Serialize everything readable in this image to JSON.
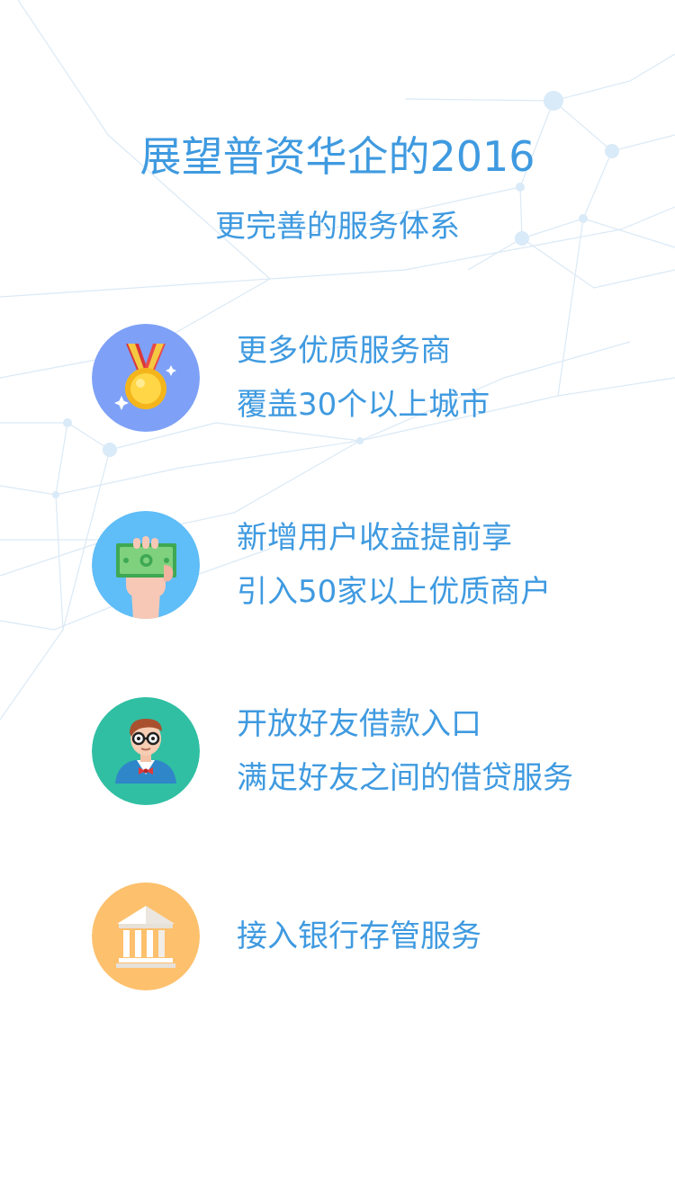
{
  "page": {
    "title": "展望普资华企的2016",
    "subtitle": "更完善的服务体系"
  },
  "theme": {
    "text_color": "#3f9ae0",
    "network_color": "#cfe3f5"
  },
  "features": [
    {
      "icon": "medal-icon",
      "icon_bg": "#7ea1f7",
      "lines": [
        "更多优质服务商",
        "覆盖30个以上城市"
      ]
    },
    {
      "icon": "money-hand-icon",
      "icon_bg": "#5fbdf7",
      "lines": [
        "新增用户收益提前享",
        "引入50家以上优质商户"
      ]
    },
    {
      "icon": "person-friend-icon",
      "icon_bg": "#30bfa3",
      "lines": [
        "开放好友借款入口",
        "满足好友之间的借贷服务"
      ]
    },
    {
      "icon": "bank-icon",
      "icon_bg": "#fdc06d",
      "lines": [
        "接入银行存管服务"
      ]
    }
  ]
}
